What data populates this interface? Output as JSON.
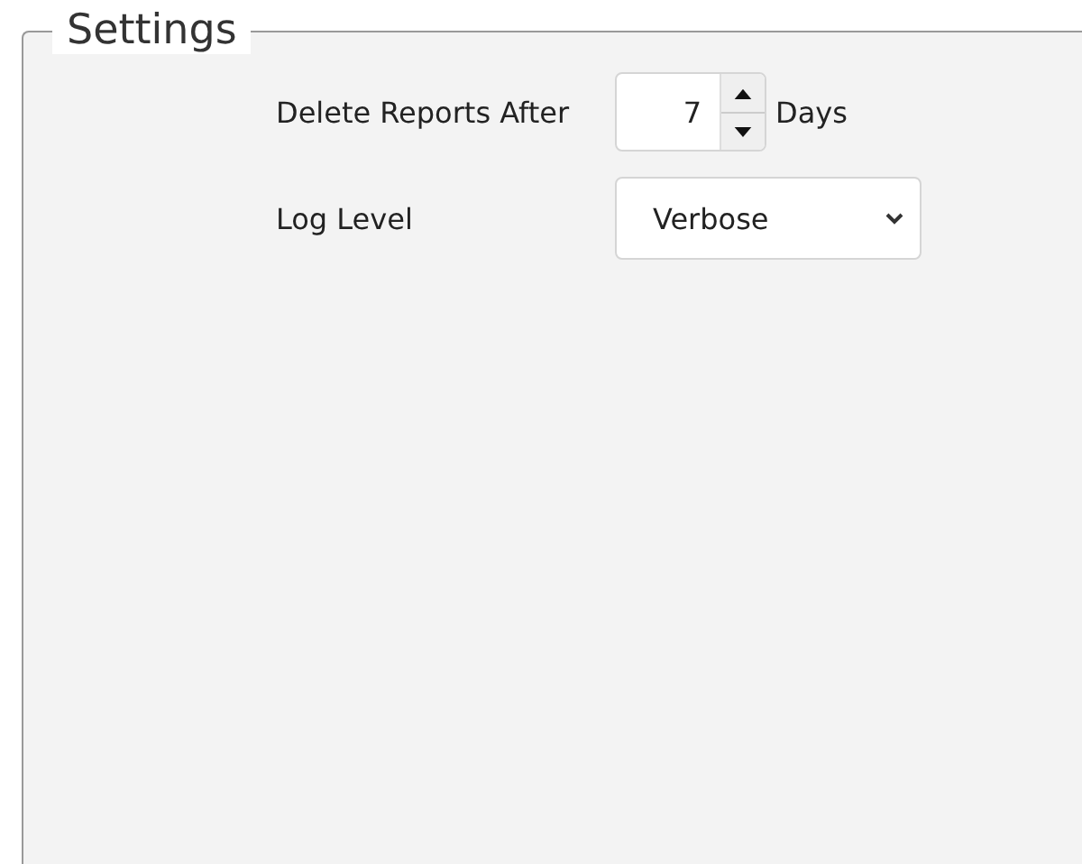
{
  "group": {
    "title": "Settings"
  },
  "delete_reports": {
    "label": "Delete Reports After",
    "value": "7",
    "unit": "Days"
  },
  "log_level": {
    "label": "Log Level",
    "value": "Verbose"
  }
}
